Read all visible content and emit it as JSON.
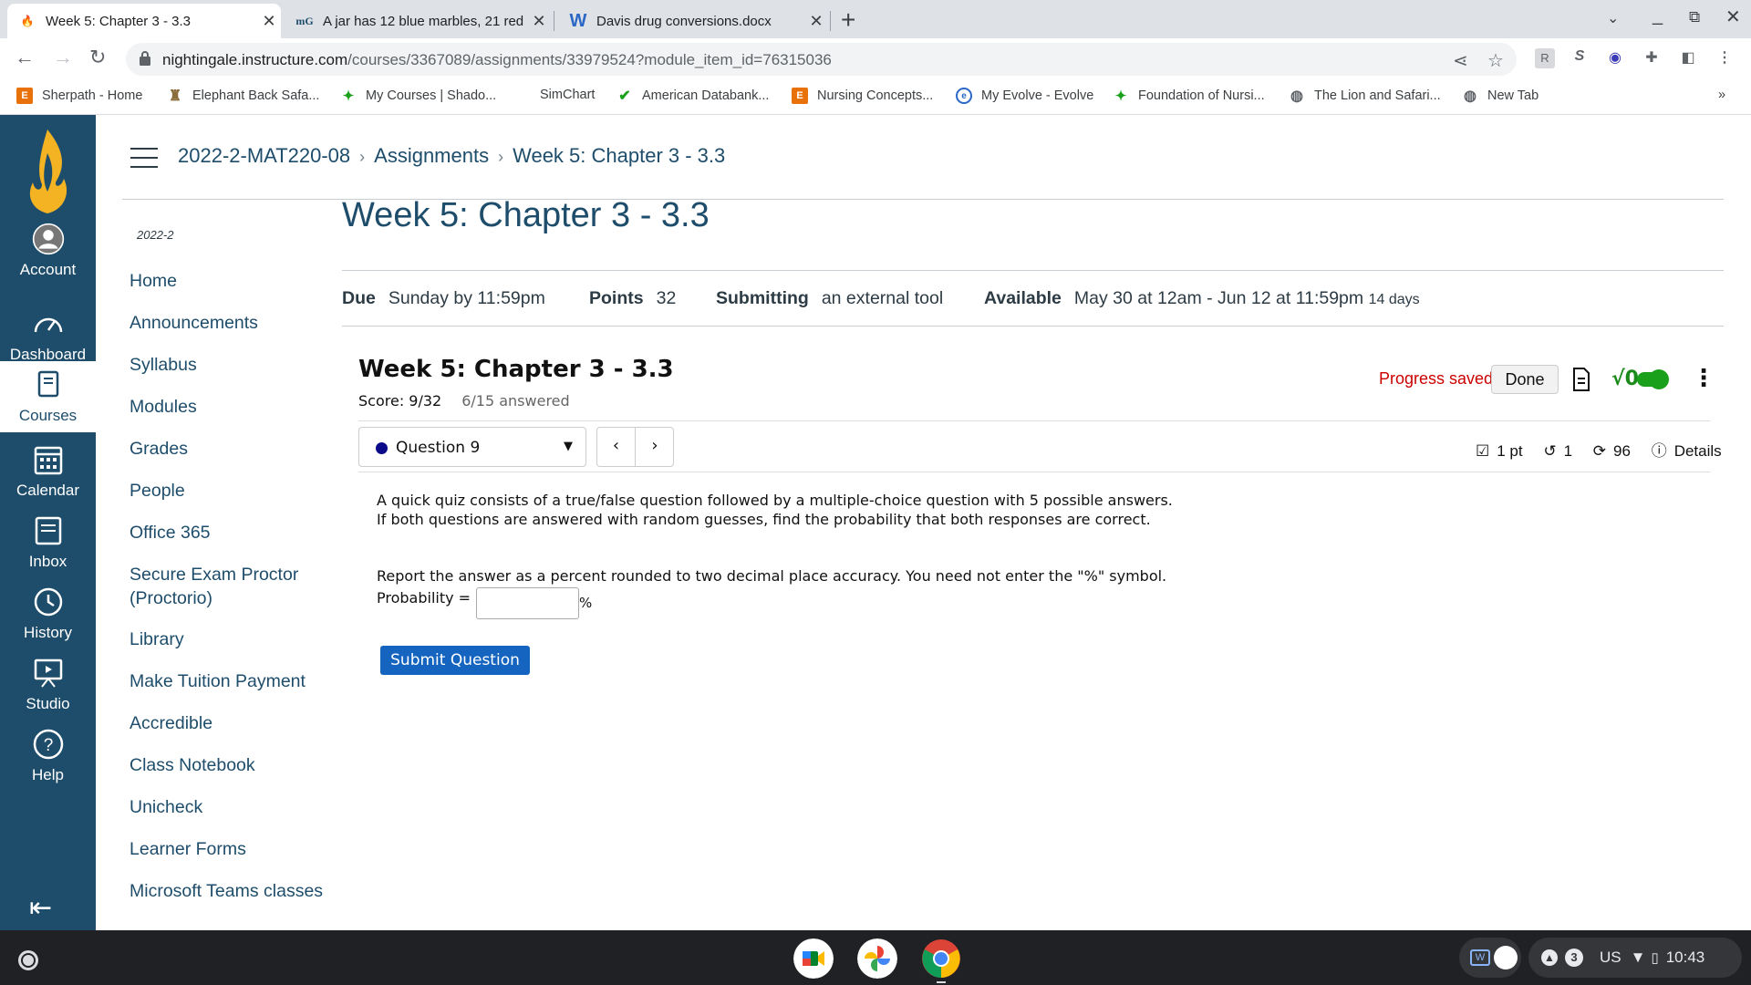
{
  "browser": {
    "tabs": [
      {
        "title": "Week 5: Chapter 3 - 3.3",
        "active": true
      },
      {
        "title": "A jar has 12 blue marbles, 21 red",
        "active": false
      },
      {
        "title": "Davis drug conversions.docx",
        "active": false
      }
    ],
    "url_host": "nightingale.instructure.com",
    "url_path": "/courses/3367089/assignments/33979524?module_item_id=76315036",
    "bookmarks": [
      "Sherpath - Home",
      "Elephant Back Safa...",
      "My Courses | Shado...",
      "SimChart",
      "American Databank...",
      "Nursing Concepts...",
      "My Evolve - Evolve",
      "Foundation of Nursi...",
      "The Lion and Safari...",
      "New Tab"
    ],
    "bookmarks_more": "»"
  },
  "global_nav": {
    "items": [
      "Account",
      "Dashboard",
      "Courses",
      "Calendar",
      "Inbox",
      "History",
      "Studio",
      "Help"
    ],
    "active": "Courses"
  },
  "breadcrumbs": [
    "2022-2-MAT220-08",
    "Assignments",
    "Week 5: Chapter 3 - 3.3"
  ],
  "course_nav": {
    "term": "2022-2",
    "items": [
      "Home",
      "Announcements",
      "Syllabus",
      "Modules",
      "Grades",
      "People",
      "Office 365",
      "Secure Exam Proctor (Proctorio)",
      "Library",
      "Make Tuition Payment",
      "Accredible",
      "Class Notebook",
      "Unicheck",
      "Learner Forms",
      "Microsoft Teams classes"
    ]
  },
  "assignment": {
    "title": "Week 5: Chapter 3 - 3.3",
    "due_label": "Due",
    "due_value": "Sunday by 11:59pm",
    "points_label": "Points",
    "points_value": "32",
    "submitting_label": "Submitting",
    "submitting_value": "an external tool",
    "available_label": "Available",
    "available_value": "May 30 at 12am - Jun 12 at 11:59pm",
    "available_days": "14 days"
  },
  "tool": {
    "title": "Week 5: Chapter 3 - 3.3",
    "score": "Score: 9/32",
    "answered": "6/15 answered",
    "progress_status": "Progress saved",
    "done_label": "Done",
    "question_select": "Question 9",
    "points": "1 pt",
    "retries": "1",
    "regens": "96",
    "details_label": "Details",
    "question_text": "A quick quiz consists of a true/false question followed by a multiple-choice question with 5 possible answers. If both questions are answered with random guesses, find the probability that both responses are correct.",
    "report_text": "Report the answer as a percent rounded to two decimal place accuracy. You need not enter the \"%\" symbol.",
    "probability_label": "Probability =",
    "answer_value": "",
    "percent_symbol": "%",
    "submit_label": "Submit Question"
  },
  "shelf": {
    "tray_count": "3",
    "locale": "US",
    "time": "10:43"
  },
  "colors": {
    "canvas_nav": "#1e4d6b",
    "link": "#1e4d6b",
    "submit": "#1565c0",
    "progress": "#cc0000",
    "toggle": "#1aa01a"
  }
}
